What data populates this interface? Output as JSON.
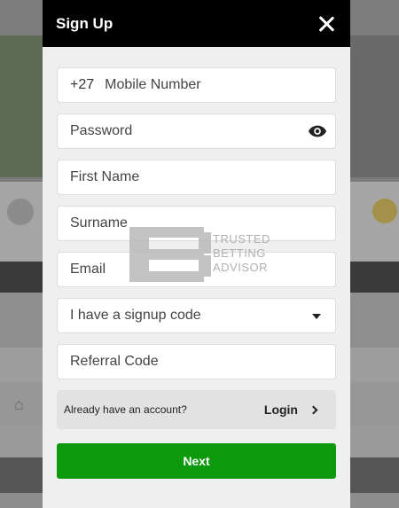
{
  "modal": {
    "title": "Sign Up",
    "close_icon": "close-icon"
  },
  "form": {
    "mobile": {
      "prefix": "+27",
      "placeholder": "Mobile Number"
    },
    "password": {
      "placeholder": "Password",
      "icon": "eye-icon"
    },
    "first_name": {
      "placeholder": "First Name"
    },
    "surname": {
      "placeholder": "Surname"
    },
    "email": {
      "placeholder": "Email"
    },
    "signup_code_select": {
      "value": "I have a signup code",
      "icon": "caret-down-icon"
    },
    "referral_code": {
      "placeholder": "Referral Code"
    }
  },
  "account": {
    "question": "Already have an account?",
    "login_label": "Login"
  },
  "actions": {
    "next_label": "Next"
  },
  "watermark": {
    "lines": [
      "TRUSTED",
      "BETTING",
      "ADVISOR"
    ]
  },
  "colors": {
    "header_bg": "#000000",
    "next_bg": "#0c9a0c",
    "modal_bg": "#efefef"
  }
}
